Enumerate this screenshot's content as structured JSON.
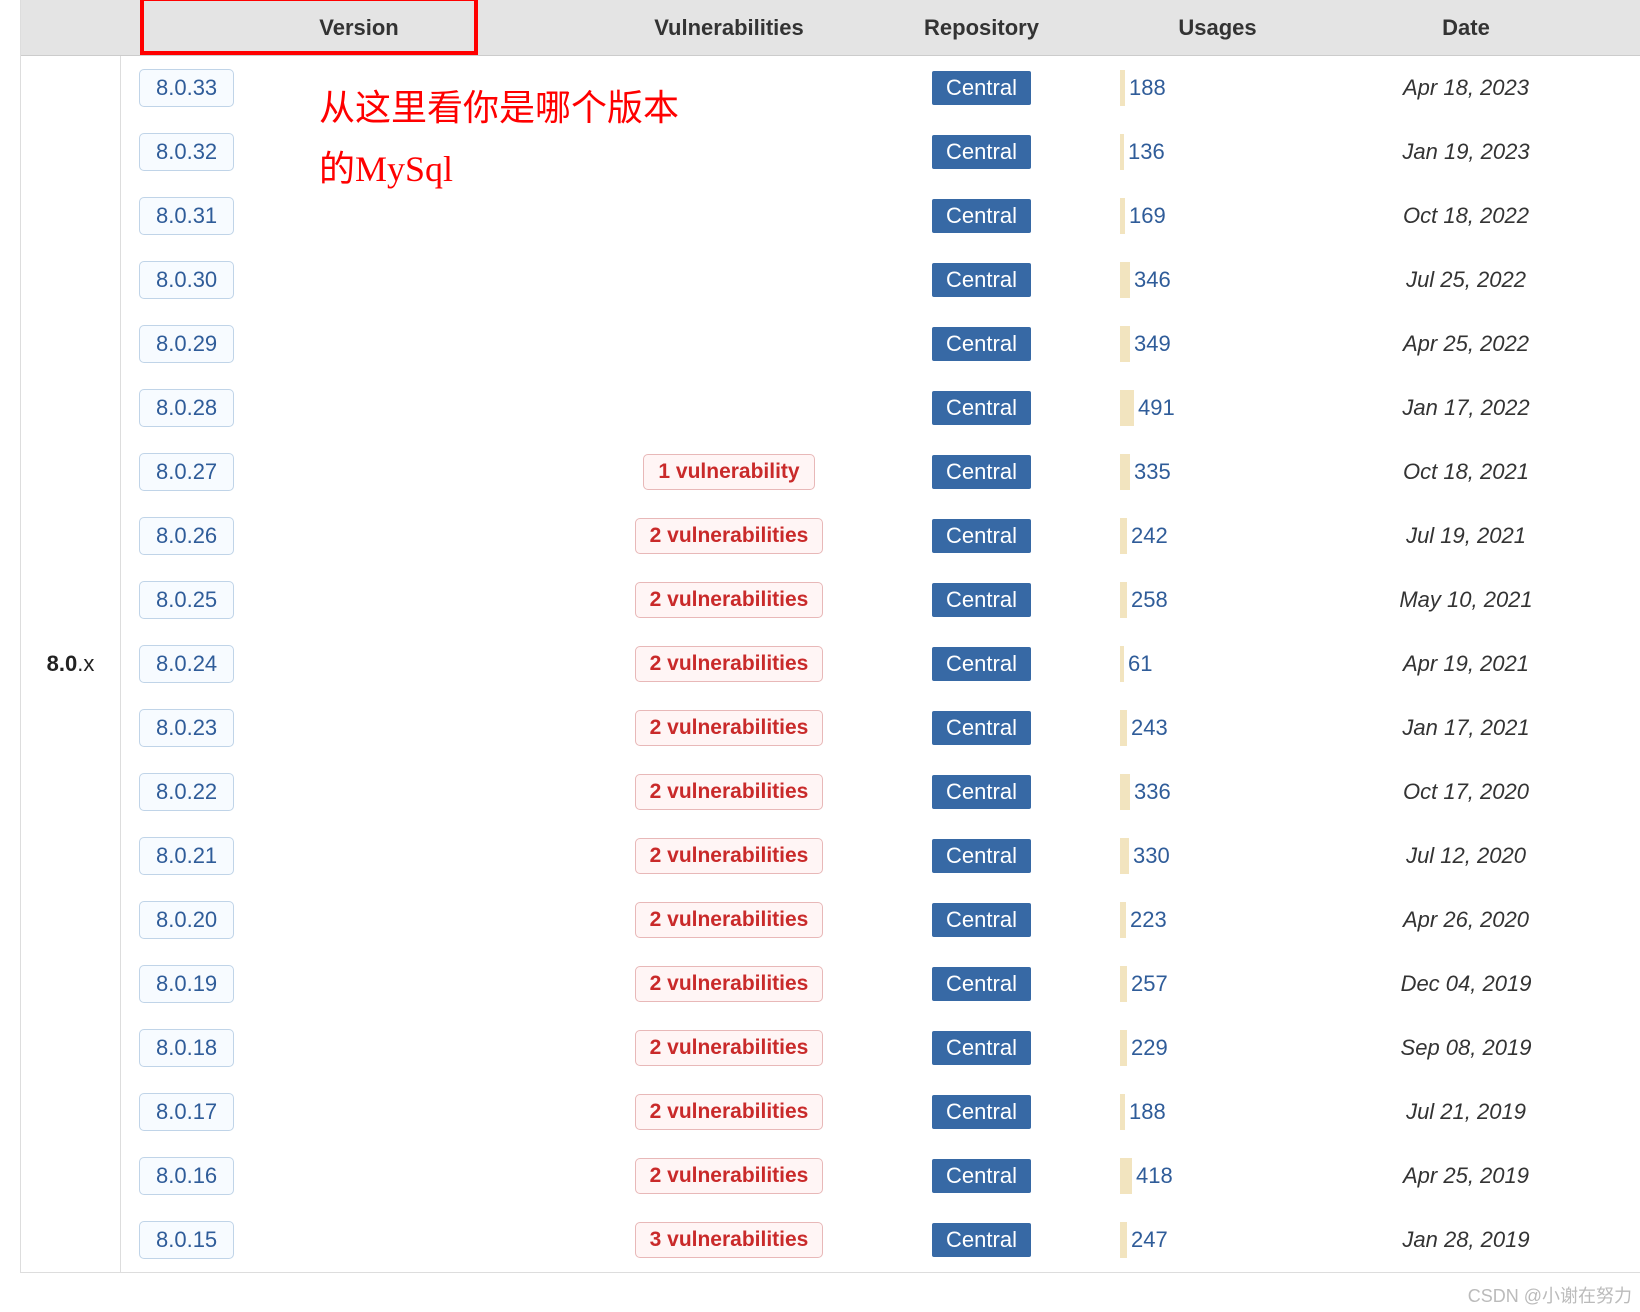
{
  "headers": {
    "version": "Version",
    "vulnerabilities": "Vulnerabilities",
    "repository": "Repository",
    "usages": "Usages",
    "date": "Date"
  },
  "group_label": {
    "bold": "8.0",
    "rest": ".x"
  },
  "annotation": {
    "line1": "从这里看你是哪个版本",
    "line2": "的MySql"
  },
  "watermark": "CSDN @小谢在努力",
  "max_usage": 491,
  "rows": [
    {
      "version": "8.0.33",
      "vuln": "",
      "repo": "Central",
      "usages": "188",
      "date": "Apr 18, 2023"
    },
    {
      "version": "8.0.32",
      "vuln": "",
      "repo": "Central",
      "usages": "136",
      "date": "Jan 19, 2023"
    },
    {
      "version": "8.0.31",
      "vuln": "",
      "repo": "Central",
      "usages": "169",
      "date": "Oct 18, 2022"
    },
    {
      "version": "8.0.30",
      "vuln": "",
      "repo": "Central",
      "usages": "346",
      "date": "Jul 25, 2022"
    },
    {
      "version": "8.0.29",
      "vuln": "",
      "repo": "Central",
      "usages": "349",
      "date": "Apr 25, 2022"
    },
    {
      "version": "8.0.28",
      "vuln": "",
      "repo": "Central",
      "usages": "491",
      "date": "Jan 17, 2022"
    },
    {
      "version": "8.0.27",
      "vuln": "1 vulnerability",
      "repo": "Central",
      "usages": "335",
      "date": "Oct 18, 2021"
    },
    {
      "version": "8.0.26",
      "vuln": "2 vulnerabilities",
      "repo": "Central",
      "usages": "242",
      "date": "Jul 19, 2021"
    },
    {
      "version": "8.0.25",
      "vuln": "2 vulnerabilities",
      "repo": "Central",
      "usages": "258",
      "date": "May 10, 2021"
    },
    {
      "version": "8.0.24",
      "vuln": "2 vulnerabilities",
      "repo": "Central",
      "usages": "61",
      "date": "Apr 19, 2021"
    },
    {
      "version": "8.0.23",
      "vuln": "2 vulnerabilities",
      "repo": "Central",
      "usages": "243",
      "date": "Jan 17, 2021"
    },
    {
      "version": "8.0.22",
      "vuln": "2 vulnerabilities",
      "repo": "Central",
      "usages": "336",
      "date": "Oct 17, 2020"
    },
    {
      "version": "8.0.21",
      "vuln": "2 vulnerabilities",
      "repo": "Central",
      "usages": "330",
      "date": "Jul 12, 2020"
    },
    {
      "version": "8.0.20",
      "vuln": "2 vulnerabilities",
      "repo": "Central",
      "usages": "223",
      "date": "Apr 26, 2020"
    },
    {
      "version": "8.0.19",
      "vuln": "2 vulnerabilities",
      "repo": "Central",
      "usages": "257",
      "date": "Dec 04, 2019"
    },
    {
      "version": "8.0.18",
      "vuln": "2 vulnerabilities",
      "repo": "Central",
      "usages": "229",
      "date": "Sep 08, 2019"
    },
    {
      "version": "8.0.17",
      "vuln": "2 vulnerabilities",
      "repo": "Central",
      "usages": "188",
      "date": "Jul 21, 2019"
    },
    {
      "version": "8.0.16",
      "vuln": "2 vulnerabilities",
      "repo": "Central",
      "usages": "418",
      "date": "Apr 25, 2019"
    },
    {
      "version": "8.0.15",
      "vuln": "3 vulnerabilities",
      "repo": "Central",
      "usages": "247",
      "date": "Jan 28, 2019"
    }
  ]
}
